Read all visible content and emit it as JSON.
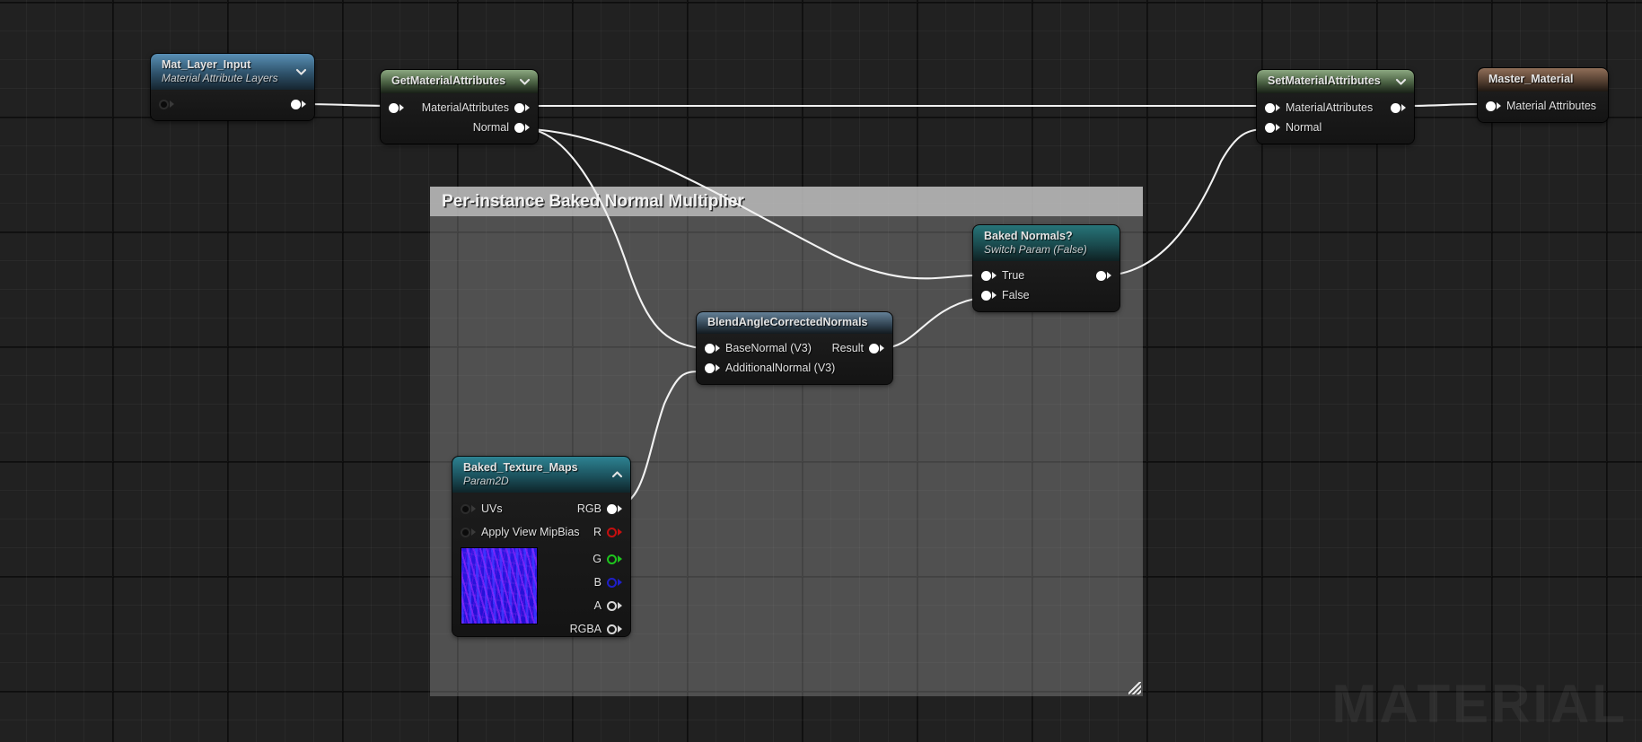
{
  "canvas": {
    "watermark": "MATERIAL",
    "background_color": "#212121",
    "grid_minor_color": "#2c2c2c",
    "grid_major_color": "#0a0a0a"
  },
  "comment": {
    "title": "Per-instance Baked Normal Multiplier",
    "header_color": "#c4c4c4",
    "body_color": "#8e8e8e"
  },
  "nodes": {
    "mat_layer_input": {
      "title": "Mat_Layer_Input",
      "subtitle": "Material Attribute Layers",
      "header_color": "#5c96be",
      "chevron": "chevron-down-icon",
      "input_pins": [
        {
          "label": ""
        }
      ],
      "output_pins": [
        {
          "label": ""
        }
      ]
    },
    "get_material_attributes": {
      "title": "GetMaterialAttributes",
      "subtitle": "",
      "header_color": "#92b086",
      "chevron": "chevron-down-icon",
      "input_pins": [
        {
          "label": ""
        }
      ],
      "output_pins": [
        {
          "label": "MaterialAttributes"
        },
        {
          "label": "Normal"
        }
      ]
    },
    "set_material_attributes": {
      "title": "SetMaterialAttributes",
      "subtitle": "",
      "header_color": "#92b086",
      "chevron": "chevron-down-icon",
      "input_pins": [
        {
          "label": "MaterialAttributes"
        },
        {
          "label": "Normal"
        }
      ],
      "output_pins": [
        {
          "label": ""
        }
      ]
    },
    "master_material": {
      "title": "Master_Material",
      "subtitle": "",
      "header_color": "#96735c",
      "input_pins": [
        {
          "label": "Material Attributes"
        }
      ],
      "output_pins": []
    },
    "baked_normals_switch": {
      "title": "Baked Normals?",
      "subtitle": "Switch Param (False)",
      "header_color": "#28787c",
      "input_pins": [
        {
          "label": "True"
        },
        {
          "label": "False"
        }
      ],
      "output_pins": [
        {
          "label": ""
        }
      ]
    },
    "blend_angle_corrected_normals": {
      "title": "BlendAngleCorrectedNormals",
      "subtitle": "",
      "header_color": "#68869e",
      "input_pins": [
        {
          "label": "BaseNormal (V3)"
        },
        {
          "label": "AdditionalNormal (V3)"
        }
      ],
      "output_pins": [
        {
          "label": "Result"
        }
      ]
    },
    "baked_texture_maps": {
      "title": "Baked_Texture_Maps",
      "subtitle": "Param2D",
      "header_color": "#2e8696",
      "chevron": "chevron-up-icon",
      "input_pins": [
        {
          "label": "UVs"
        },
        {
          "label": "Apply View MipBias"
        }
      ],
      "output_pins": [
        {
          "label": "RGB",
          "color": "#ffffff"
        },
        {
          "label": "R",
          "color": "#c50f0f"
        },
        {
          "label": "G",
          "color": "#1ec41e"
        },
        {
          "label": "B",
          "color": "#1f1fc8"
        },
        {
          "label": "A",
          "color": "#d8d8d8"
        },
        {
          "label": "RGBA",
          "color": "#d8d8d8"
        }
      ],
      "thumbnail": "normal-map-texture-preview"
    }
  }
}
